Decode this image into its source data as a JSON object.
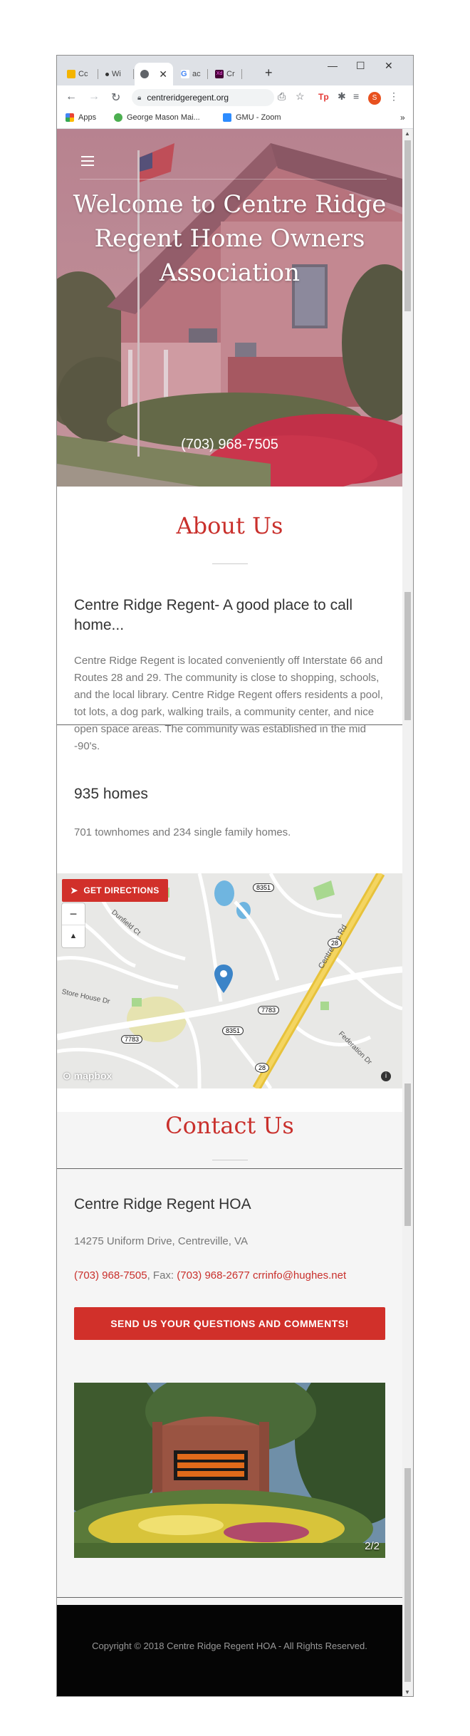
{
  "browser": {
    "tabs": [
      {
        "label": "Cc",
        "favicon_color": "#f4b400"
      },
      {
        "label": "Wi",
        "favicon_color": "#ffffff"
      },
      {
        "label": "",
        "favicon_color": "#5f6368",
        "close": "✕"
      },
      {
        "label": "ac",
        "favicon_color": "#4285f4"
      },
      {
        "label": "Cr",
        "favicon_color": "#470137"
      }
    ],
    "new_tab": "+",
    "window_controls": [
      "—",
      "☐",
      "✕"
    ],
    "url": "centreridgeregent.org",
    "bookmarks": [
      {
        "label": "Apps",
        "icon_color": "#ea4335"
      },
      {
        "label": "George Mason Mai...",
        "icon_color": "#4caf50"
      },
      {
        "label": "GMU - Zoom",
        "icon_color": "#2d8cff"
      }
    ],
    "profile_initial": "S",
    "overflow": "»"
  },
  "hero": {
    "title": "Welcome to Centre Ridge Regent Home Owners Association",
    "phone": "(703) 968-7505"
  },
  "about": {
    "title": "About Us",
    "heading": "Centre Ridge Regent- A good place to call home...",
    "body": "Centre Ridge Regent is located conveniently off Interstate 66 and Routes 28 and 29. The community is close to shopping, schools, and the local library. Centre Ridge Regent offers residents a pool, tot lots, a dog park, walking trails, a community center, and nice open space areas. The community was established in the mid -90's.",
    "homes_heading": "935 homes",
    "homes_body": "701 townhomes and 234 single family homes."
  },
  "map": {
    "directions_label": "GET DIRECTIONS",
    "zoom_out": "−",
    "compass": "▲",
    "logo": "mapbox",
    "info": "i",
    "road_labels": [
      "Centreville Rd",
      "Store House Dr",
      "Dunfield Ct",
      "Federation Dr"
    ],
    "route_shields": [
      "8351",
      "28",
      "7783",
      "8351",
      "7783",
      "28"
    ]
  },
  "contact": {
    "title": "Contact Us",
    "org": "Centre Ridge Regent HOA",
    "address": "14275 Uniform Drive, Centreville, VA",
    "phone": "(703) 968-7505",
    "fax_label": ", Fax: ",
    "fax": "(703) 968-2677",
    "email": "crrinfo@hughes.net",
    "button": "SEND US YOUR QUESTIONS AND COMMENTS!",
    "photo_counter": "2/2"
  },
  "footer": {
    "text": "Copyright © 2018 Centre Ridge Regent HOA - All Rights Reserved."
  }
}
